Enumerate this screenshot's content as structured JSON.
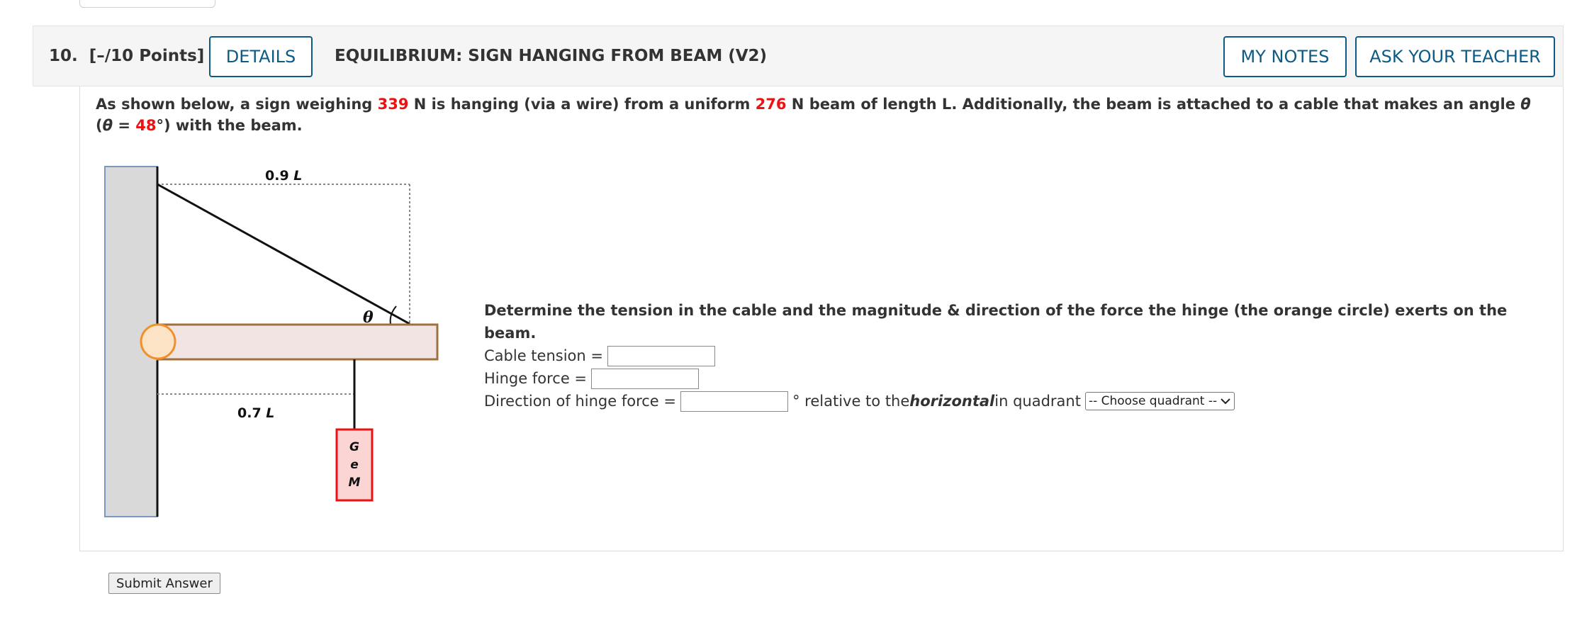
{
  "question": {
    "number": "10.",
    "points": "[–/10 Points]",
    "details_label": "DETAILS",
    "title": "EQUILIBRIUM: SIGN HANGING FROM BEAM (V2)",
    "my_notes_label": "MY NOTES",
    "ask_teacher_label": "ASK YOUR TEACHER"
  },
  "prompt": {
    "part1": "As shown below, a sign weighing ",
    "sign_weight": "339",
    "part2": " N is hanging (via a wire) from a uniform ",
    "beam_weight": "276",
    "part3": " N beam of length L. Additionally, the beam is attached to a cable that makes an angle ",
    "theta_symbol": "θ",
    "part4": " (",
    "theta_symbol2": "θ",
    "part5": " = ",
    "angle": "48",
    "part6": "°) with the beam."
  },
  "diagram": {
    "top_label_num": "0.9 ",
    "top_label_var": "L",
    "bottom_label_num": "0.7 ",
    "bottom_label_var": "L",
    "theta_label": "θ",
    "sign_letters": [
      "G",
      "e",
      "M"
    ],
    "colors": {
      "wall": "#d9d9d9",
      "wall_border": "#7b98c2",
      "beam": "#f2e4e2",
      "beam_border": "#a0703f",
      "hinge": "#fde3c6",
      "hinge_border": "#f0902a",
      "sign_fill": "#fbd4d4",
      "sign_border": "#ee1111"
    }
  },
  "form": {
    "lead": "Determine the tension in the cable and the magnitude & direction of the force the hinge (the orange circle) exerts on the beam.",
    "cable_tension_label": "Cable tension =",
    "hinge_force_label": "Hinge force =",
    "direction_label": "Direction of hinge force =",
    "degree_text": "° relative to the ",
    "horizontal_text": "horizontal",
    "quadrant_text": " in quadrant",
    "quadrant_select": "-- Choose quadrant --"
  },
  "submit_label": "Submit Answer"
}
